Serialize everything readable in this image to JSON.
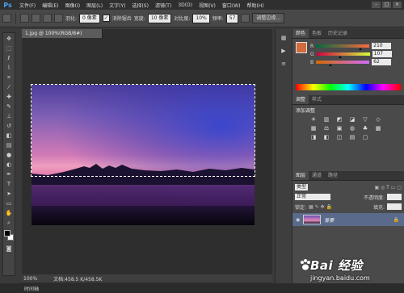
{
  "app": {
    "logo": "Ps"
  },
  "menu": [
    "文件(F)",
    "编辑(E)",
    "图像(I)",
    "图层(L)",
    "文字(Y)",
    "选择(S)",
    "滤镜(T)",
    "3D(D)",
    "视图(V)",
    "窗口(W)",
    "帮助(H)"
  ],
  "window_controls": [
    "–",
    "□",
    "×"
  ],
  "options": {
    "feather_label": "羽化:",
    "feather_value": "0 像素",
    "antialias_label": "消除锯齿",
    "style_label": "样式:",
    "style_value": "正常",
    "width_label": "宽度:",
    "width_value": "10 像素",
    "contrast_label": "对比度:",
    "contrast_value": "10%",
    "freq_label": "频率:",
    "freq_value": "57",
    "refine_edge": "调整边缘..."
  },
  "document": {
    "tab_title": "1.jpg @ 100%(RGB/8#)",
    "zoom": "100%",
    "doc_size": "文档:458.5 K/458.5K"
  },
  "bottom": {
    "label": "时间轴"
  },
  "color_panel": {
    "tabs": [
      "颜色",
      "色板",
      "历史记录"
    ],
    "r_label": "R",
    "r": 210,
    "g_label": "G",
    "g": 107,
    "b_label": "B",
    "b": 62,
    "fg_color": "#d26b3e"
  },
  "adjust_panel": {
    "tabs": [
      "调整",
      "样式"
    ],
    "title": "添加调整",
    "row1": [
      "☀",
      "▥",
      "◩",
      "◪",
      "▽",
      "◇"
    ],
    "row2": [
      "▦",
      "⚖",
      "▣",
      "◍",
      "♣",
      "▩"
    ],
    "row3": [
      "◨",
      "◧",
      "◫",
      "▤",
      "▢"
    ]
  },
  "layers_panel": {
    "tabs": [
      "图层",
      "通道",
      "路径"
    ],
    "kind": "类型",
    "blend": "正常",
    "opacity_label": "不透明度:",
    "lock_label": "锁定:",
    "fill_label": "填充:",
    "layer_name": "背景"
  },
  "watermark": {
    "brand": "Bai 经验",
    "url": "jingyan.baidu.com"
  }
}
